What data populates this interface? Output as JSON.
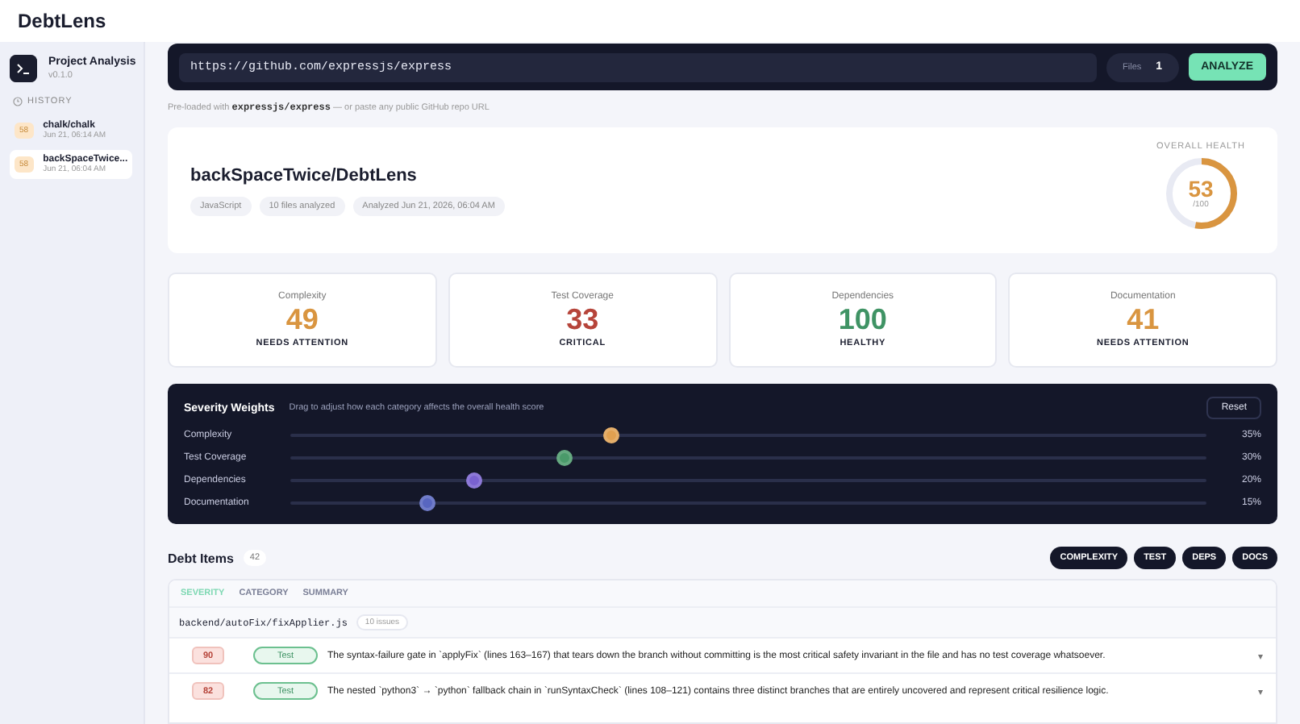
{
  "app": {
    "title": "DebtLens"
  },
  "sidebar": {
    "title": "Project Analysis",
    "version": "v0.1.0",
    "history_label": "HISTORY",
    "history": [
      {
        "score": "58",
        "name": "chalk/chalk",
        "date": "Jun 21, 06:14 AM",
        "selected": false
      },
      {
        "score": "58",
        "name": "backSpaceTwice...",
        "date": "Jun 21, 06:04 AM",
        "selected": true
      }
    ]
  },
  "url_bar": {
    "value": "https://github.com/expressjs/express",
    "files_label": "Files",
    "files_value": "1",
    "button": "ANALYZE"
  },
  "hint": {
    "prefix": "Pre-loaded with",
    "code": "expressjs/express",
    "suffix": "— or paste any public GitHub repo URL"
  },
  "project": {
    "name": "backSpaceTwice/DebtLens",
    "tags": [
      "JavaScript",
      "10 files analyzed",
      "Analyzed Jun 21, 2026, 06:04 AM"
    ],
    "health_label": "OVERALL HEALTH",
    "health_score": "53",
    "health_max": "/100",
    "level": 0.53
  },
  "scores": [
    {
      "label": "Complexity",
      "value": "49",
      "status": "NEEDS ATTENTION",
      "kind": "warn"
    },
    {
      "label": "Test Coverage",
      "value": "33",
      "status": "CRITICAL",
      "kind": "critical"
    },
    {
      "label": "Dependencies",
      "value": "100",
      "status": "HEALTHY",
      "kind": "healthy"
    },
    {
      "label": "Documentation",
      "value": "41",
      "status": "NEEDS ATTENTION",
      "kind": "warn"
    }
  ],
  "weights": {
    "title": "Severity Weights",
    "subtitle": "Drag to adjust how each category affects the overall health score",
    "reset": "Reset",
    "items": [
      {
        "label": "Complexity",
        "level": 0.35,
        "reading": "35%",
        "color": "#e0a050"
      },
      {
        "label": "Test Coverage",
        "level": 0.3,
        "reading": "30%",
        "color": "#4a9a6a"
      },
      {
        "label": "Dependencies",
        "level": 0.2,
        "reading": "20%",
        "color": "#7a62d0"
      },
      {
        "label": "Documentation",
        "level": 0.15,
        "reading": "15%",
        "color": "#5866c0"
      }
    ]
  },
  "debt": {
    "title": "Debt Items",
    "count": "42",
    "filters": [
      {
        "label": "COMPLEXITY",
        "selected": true
      },
      {
        "label": "TEST",
        "selected": true
      },
      {
        "label": "DEPS",
        "selected": true
      },
      {
        "label": "DOCS",
        "selected": true
      }
    ],
    "tabs": [
      {
        "label": "SEVERITY",
        "selected": true
      },
      {
        "label": "CATEGORY",
        "selected": false
      },
      {
        "label": "SUMMARY",
        "selected": false
      }
    ],
    "file": "backend/autoFix/fixApplier.js",
    "file_count": "10 issues",
    "rows": [
      {
        "score": "90",
        "category": "Test",
        "text": "The syntax-failure gate in `applyFix` (lines 163–167) that tears down the branch without committing is the most critical safety invariant in the file and has no test coverage whatsoever.",
        "expand": "▾"
      },
      {
        "score": "82",
        "category": "Test",
        "text": "The nested `python3` → `python` fallback chain in `runSyntaxCheck` (lines 108–121) contains three distinct branches that are entirely uncovered and represent critical resilience logic.",
        "expand": "▾"
      }
    ]
  }
}
